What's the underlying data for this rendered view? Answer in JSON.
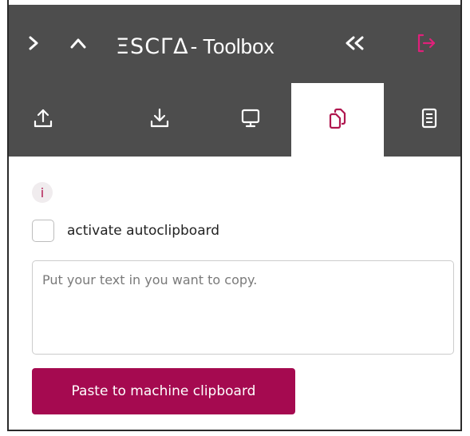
{
  "header": {
    "logo": "ΞSCΓΔ",
    "title": "- Toolbox",
    "icons": [
      "chevron-right-icon",
      "chevron-up-icon",
      "double-chevron-left-icon",
      "logout-icon"
    ]
  },
  "tabs": [
    {
      "icon": "upload-icon",
      "active": false
    },
    {
      "icon": "download-icon",
      "active": false
    },
    {
      "icon": "monitor-icon",
      "active": false
    },
    {
      "icon": "clipboard-copy-icon",
      "active": true
    },
    {
      "icon": "document-icon",
      "active": false
    }
  ],
  "clipboard": {
    "info_label": "i",
    "autoclipboard_label": "activate autoclipboard",
    "autoclipboard_checked": false,
    "textarea_value": "",
    "textarea_placeholder": "Put your text in you want to copy.",
    "paste_button_label": "Paste to machine clipboard"
  },
  "colors": {
    "header_bg": "#4d4d4d",
    "accent": "#a50a50",
    "logout_icon": "#e0207a",
    "active_tab_icon": "#b0174f"
  }
}
